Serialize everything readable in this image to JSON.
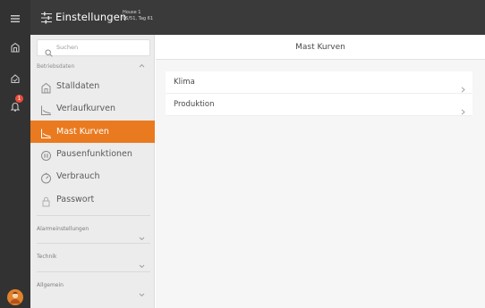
{
  "topbar": {
    "title": "Einstellungen",
    "house_name": "House 1",
    "house_info": "06/51, Tag 61"
  },
  "rail": {
    "notification_count": "1",
    "icons": [
      "menu-icon",
      "barn-icon",
      "clipboard-icon",
      "bell-icon",
      "avatar"
    ]
  },
  "sidebar": {
    "search_placeholder": "Suchen",
    "section_label": "Betriebsdaten",
    "items": [
      {
        "label": "Stalldaten",
        "icon": "barn-icon"
      },
      {
        "label": "Verlaufkurven",
        "icon": "line-chart-icon"
      },
      {
        "label": "Mast Kurven",
        "icon": "line-chart-icon",
        "active": true
      },
      {
        "label": "Pausenfunktionen",
        "icon": "pause-icon"
      },
      {
        "label": "Verbrauch",
        "icon": "gauge-icon"
      },
      {
        "label": "Passwort",
        "icon": "lock-icon"
      }
    ],
    "groups": [
      {
        "label": "Alarmeinstellungen"
      },
      {
        "label": "Technik"
      },
      {
        "label": "Allgemein"
      }
    ]
  },
  "main": {
    "title": "Mast Kurven",
    "rows": [
      {
        "label": "Klima"
      },
      {
        "label": "Produktion"
      }
    ]
  },
  "colors": {
    "accent": "#ea7a1f",
    "topbar": "#3a3a3a",
    "rail": "#323232",
    "badge": "#e84e3c"
  }
}
